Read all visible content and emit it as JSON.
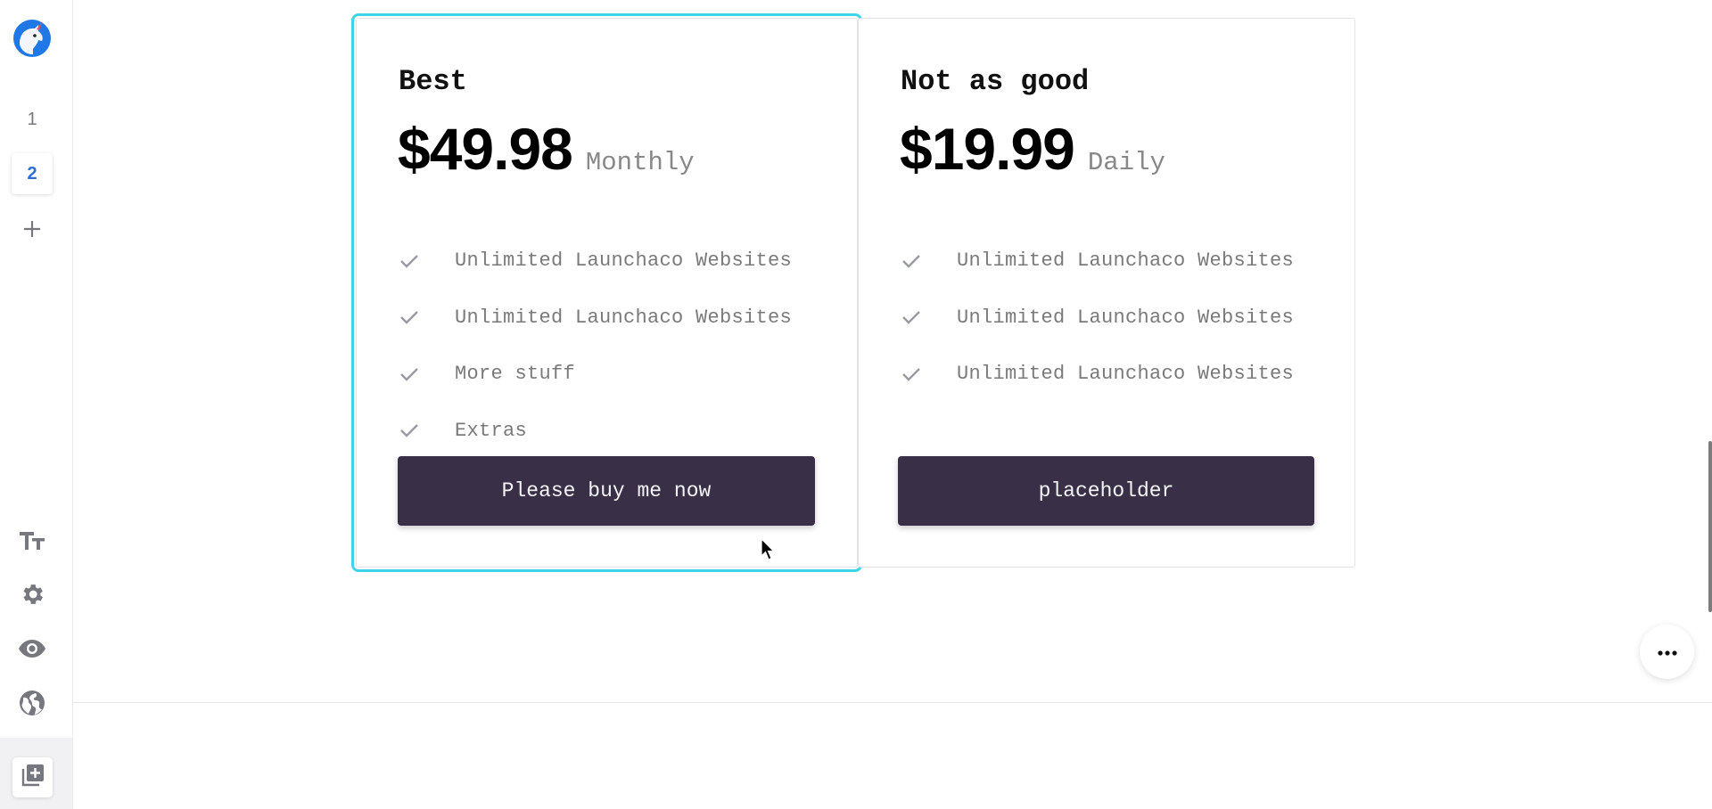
{
  "sidebar": {
    "logo": {
      "icon": "unicorn-logo-icon",
      "colors": {
        "primary": "#1f78e6",
        "horn": "#e0566c"
      }
    },
    "pages": [
      {
        "label": "1",
        "active": false
      },
      {
        "label": "2",
        "active": true
      }
    ],
    "add_page_icon": "plus-icon",
    "tools": [
      {
        "name": "typography",
        "icon": "text-size-icon"
      },
      {
        "name": "settings",
        "icon": "gear-icon"
      },
      {
        "name": "preview",
        "icon": "eye-icon"
      },
      {
        "name": "publish",
        "icon": "globe-icon"
      }
    ],
    "add_section_icon": "add-section-icon"
  },
  "pricing": {
    "cards": [
      {
        "name": "Best",
        "price": "$49.98",
        "period": "Monthly",
        "selected": true,
        "features": [
          "Unlimited Launchaco Websites",
          "Unlimited Launchaco Websites",
          "More stuff",
          "Extras"
        ],
        "button_label": "Please buy me now"
      },
      {
        "name": "Not as good",
        "price": "$19.99",
        "period": "Daily",
        "selected": false,
        "features": [
          "Unlimited Launchaco Websites",
          "Unlimited Launchaco Websites",
          "Unlimited Launchaco Websites"
        ],
        "button_label": "placeholder"
      }
    ]
  },
  "floating": {
    "more_icon": "more-horizontal-icon"
  },
  "colors": {
    "selection_outline": "#3fd3e8",
    "button_bg": "#392f47",
    "active_page": "#2d6fd6",
    "icon_gray": "#77777f"
  }
}
